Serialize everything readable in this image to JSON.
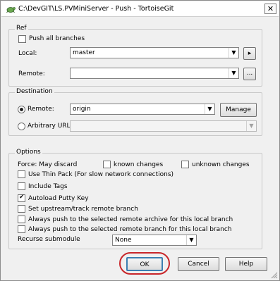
{
  "window": {
    "title": "C:\\DevGIT\\LS.PVMiniServer - Push - TortoiseGit",
    "close_label": "✕"
  },
  "ref": {
    "legend": "Ref",
    "push_all_branches": {
      "label": "Push all branches",
      "checked": false
    },
    "local_label": "Local:",
    "local_value": "master",
    "local_button_label": "▸",
    "remote_label": "Remote:",
    "remote_value": "",
    "remote_button_label": "..."
  },
  "destination": {
    "legend": "Destination",
    "remote_radio_label": "Remote:",
    "remote_selected": true,
    "remote_value": "origin",
    "manage_label": "Manage",
    "arbitrary_radio_label": "Arbitrary URL:",
    "arbitrary_value": ""
  },
  "options": {
    "legend": "Options",
    "force_label": "Force: May discard",
    "known_changes": {
      "label": "known changes",
      "checked": false
    },
    "unknown_changes": {
      "label": "unknown changes",
      "checked": false
    },
    "thin_pack": {
      "label": "Use Thin Pack (For slow network connections)",
      "checked": false
    },
    "include_tags": {
      "label": "Include Tags",
      "checked": false
    },
    "autoload_putty": {
      "label": "Autoload Putty Key",
      "checked": true
    },
    "set_upstream": {
      "label": "Set upstream/track remote branch",
      "checked": false
    },
    "push_archive": {
      "label": "Always push to the selected remote archive for this local branch",
      "checked": false
    },
    "push_branch": {
      "label": "Always push to the selected remote branch for this local branch",
      "checked": false
    },
    "recurse_label": "Recurse submodule",
    "recurse_value": "None"
  },
  "buttons": {
    "ok": "OK",
    "cancel": "Cancel",
    "help": "Help"
  },
  "icons": {
    "dropdown": "▼"
  },
  "colors": {
    "highlight_ring": "#c8262a",
    "default_button_border": "#3c7fb1"
  }
}
